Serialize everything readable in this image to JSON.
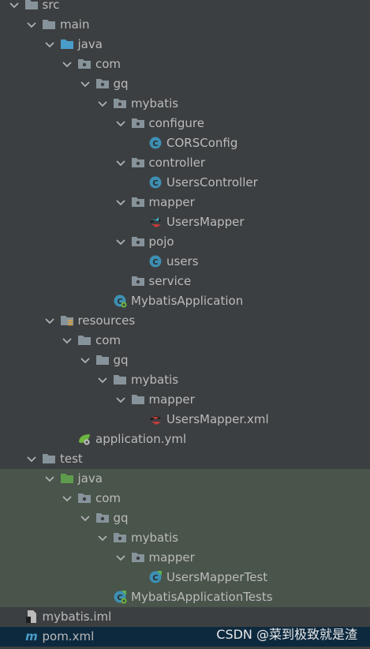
{
  "tree": [
    {
      "label": "src",
      "depth": 1,
      "icon": "folder-icon",
      "expanded": true
    },
    {
      "label": "main",
      "depth": 2,
      "icon": "folder-icon",
      "expanded": true
    },
    {
      "label": "java",
      "depth": 3,
      "icon": "source-folder-icon",
      "expanded": true
    },
    {
      "label": "com",
      "depth": 4,
      "icon": "package-icon",
      "expanded": true
    },
    {
      "label": "gq",
      "depth": 5,
      "icon": "package-icon",
      "expanded": true
    },
    {
      "label": "mybatis",
      "depth": 6,
      "icon": "package-icon",
      "expanded": true
    },
    {
      "label": "configure",
      "depth": 7,
      "icon": "package-icon",
      "expanded": true
    },
    {
      "label": "CORSConfig",
      "depth": 8,
      "icon": "java-class-icon"
    },
    {
      "label": "controller",
      "depth": 7,
      "icon": "package-icon",
      "expanded": true
    },
    {
      "label": "UsersController",
      "depth": 8,
      "icon": "java-class-icon"
    },
    {
      "label": "mapper",
      "depth": 7,
      "icon": "package-icon",
      "expanded": true
    },
    {
      "label": "UsersMapper",
      "depth": 8,
      "icon": "mybatis-mapper-icon"
    },
    {
      "label": "pojo",
      "depth": 7,
      "icon": "package-icon",
      "expanded": true
    },
    {
      "label": "users",
      "depth": 8,
      "icon": "java-class-icon"
    },
    {
      "label": "service",
      "depth": 7,
      "icon": "package-icon"
    },
    {
      "label": "MybatisApplication",
      "depth": 6,
      "icon": "spring-boot-class-icon"
    },
    {
      "label": "resources",
      "depth": 3,
      "icon": "resources-folder-icon",
      "expanded": true
    },
    {
      "label": "com",
      "depth": 4,
      "icon": "folder-icon",
      "expanded": true
    },
    {
      "label": "gq",
      "depth": 5,
      "icon": "folder-icon",
      "expanded": true
    },
    {
      "label": "mybatis",
      "depth": 6,
      "icon": "folder-icon",
      "expanded": true
    },
    {
      "label": "mapper",
      "depth": 7,
      "icon": "folder-icon",
      "expanded": true
    },
    {
      "label": "UsersMapper.xml",
      "depth": 8,
      "icon": "mybatis-xml-icon"
    },
    {
      "label": "application.yml",
      "depth": 4,
      "icon": "spring-yml-icon"
    },
    {
      "label": "test",
      "depth": 2,
      "icon": "folder-icon",
      "expanded": true
    },
    {
      "label": "java",
      "depth": 3,
      "icon": "test-folder-icon",
      "expanded": true,
      "test_root": true
    },
    {
      "label": "com",
      "depth": 4,
      "icon": "package-icon",
      "expanded": true,
      "test_root": true
    },
    {
      "label": "gq",
      "depth": 5,
      "icon": "package-icon",
      "expanded": true,
      "test_root": true
    },
    {
      "label": "mybatis",
      "depth": 6,
      "icon": "package-icon",
      "expanded": true,
      "test_root": true
    },
    {
      "label": "mapper",
      "depth": 7,
      "icon": "package-icon",
      "expanded": true,
      "test_root": true
    },
    {
      "label": "UsersMapperTest",
      "depth": 8,
      "icon": "test-class-icon",
      "test_root": true
    },
    {
      "label": "MybatisApplicationTests",
      "depth": 6,
      "icon": "spring-boot-test-icon",
      "test_root": true
    },
    {
      "label": "mybatis.iml",
      "depth": 1,
      "icon": "iml-file-icon"
    },
    {
      "label": "pom.xml",
      "depth": 1,
      "icon": "maven-pom-icon",
      "selected": true
    }
  ],
  "watermark": "CSDN @菜到极致就是渣",
  "colors": {
    "background": "#3c3f41",
    "test_highlight": "#49544a",
    "selected": "#0d293e",
    "folder": "#87939a",
    "source_folder": "#4a9cc9",
    "test_folder": "#5f9b4c",
    "class_circle": "#3d8fb3",
    "text": "#bbbbbb"
  }
}
